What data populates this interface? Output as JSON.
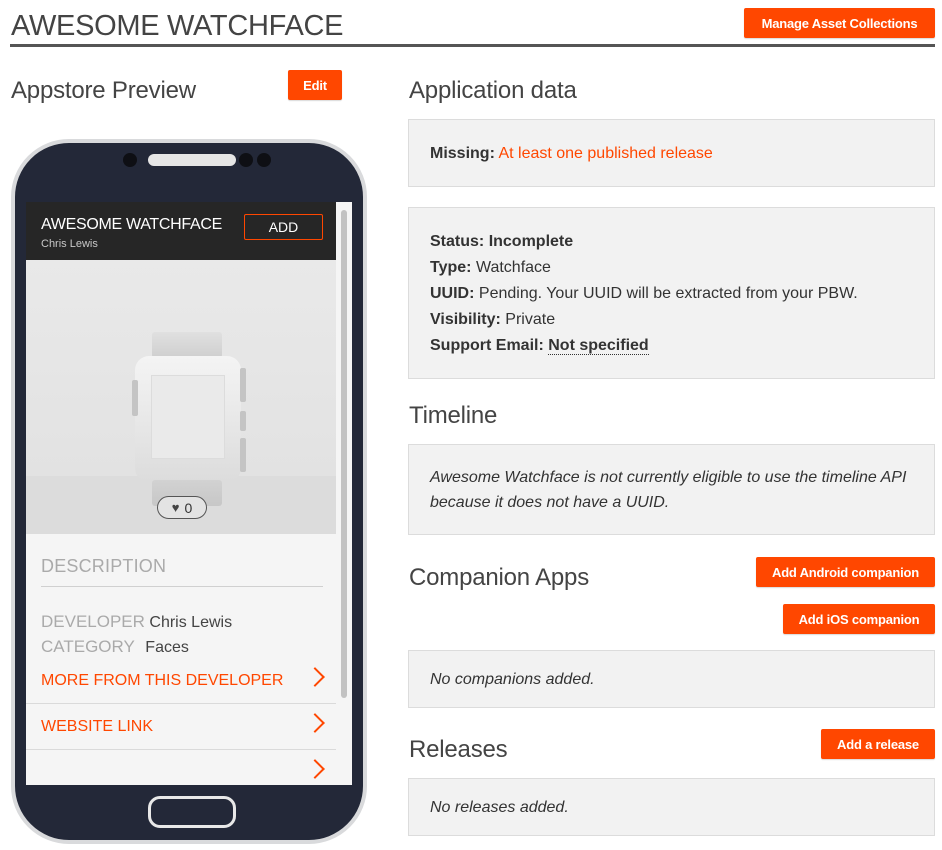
{
  "header": {
    "title": "AWESOME WATCHFACE",
    "manage_label": "Manage Asset Collections"
  },
  "preview": {
    "title": "Appstore Preview",
    "edit_label": "Edit",
    "app_name": "AWESOME WATCHFACE",
    "app_developer": "Chris Lewis",
    "add_label": "ADD",
    "likes": "0",
    "description_heading": "DESCRIPTION",
    "developer_key": "DEVELOPER",
    "developer_value": "Chris Lewis",
    "category_key": "CATEGORY",
    "category_value": "Faces",
    "more_link": "MORE FROM THIS DEVELOPER",
    "website_link": "WEBSITE LINK"
  },
  "application_data": {
    "title": "Application data",
    "missing_key": "Missing:",
    "missing_value": "At least one published release",
    "status_key": "Status:",
    "status_value": "Incomplete",
    "type_key": "Type:",
    "type_value": "Watchface",
    "uuid_key": "UUID:",
    "uuid_value": "Pending. Your UUID will be extracted from your PBW.",
    "visibility_key": "Visibility:",
    "visibility_value": "Private",
    "support_key": "Support Email:",
    "support_value": "Not specified"
  },
  "timeline": {
    "title": "Timeline",
    "line1": "Awesome Watchface is not currently eligible to use the timeline API",
    "line2": "because it does not have a UUID."
  },
  "companions": {
    "title": "Companion Apps",
    "android_label": "Add Android companion",
    "ios_label": "Add iOS companion",
    "empty_text": "No companions added."
  },
  "releases": {
    "title": "Releases",
    "add_label": "Add a release",
    "empty_text": "No releases added."
  },
  "colors": {
    "accent": "#ff4700",
    "phone_body": "#232838",
    "panel_bg": "#f2f2f2"
  },
  "icons": [
    "heart-icon",
    "chevron-right-icon",
    "watch-image"
  ]
}
